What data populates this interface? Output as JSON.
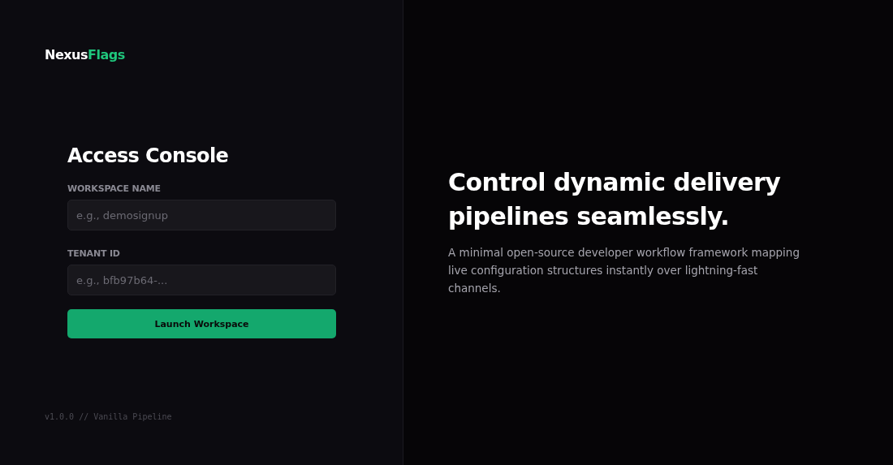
{
  "brand": {
    "prefix": "Nexus",
    "accent": "Flags"
  },
  "form": {
    "title": "Access Console",
    "fields": [
      {
        "label": "WORKSPACE NAME",
        "placeholder": "e.g., demosignup"
      },
      {
        "label": "TENANT ID",
        "placeholder": "e.g., bfb97b64-..."
      }
    ],
    "submit": "Launch Workspace"
  },
  "footer": "v1.0.0 // Vanilla Pipeline",
  "hero": {
    "headline": "Control dynamic delivery pipelines seamlessly.",
    "description": "A minimal open-source developer workflow framework mapping live configuration structures instantly over lightning-fast channels."
  }
}
